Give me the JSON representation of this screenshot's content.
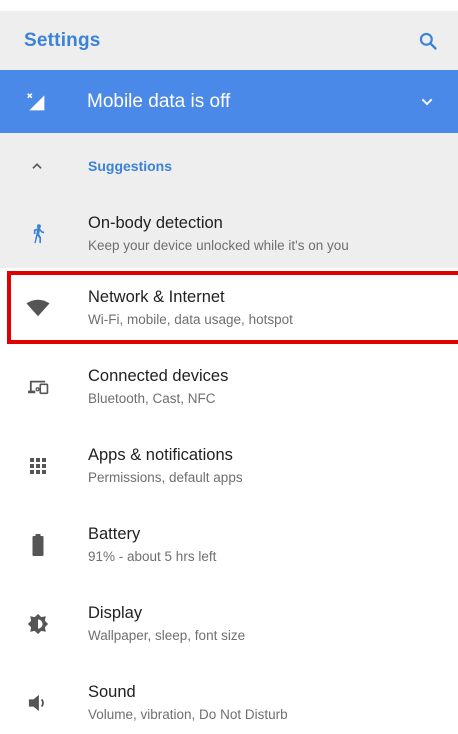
{
  "app_bar": {
    "title": "Settings",
    "search_icon": "search-icon"
  },
  "banner": {
    "text": "Mobile data is off",
    "icon": "signal-off-icon",
    "chevron": "chevron-down-icon"
  },
  "suggestions": {
    "title": "Suggestions",
    "items": [
      {
        "title": "On-body detection",
        "subtitle": "Keep your device unlocked while it's on you",
        "icon": "walking-person-icon"
      }
    ]
  },
  "settings": [
    {
      "title": "Network & Internet",
      "subtitle": "Wi-Fi, mobile, data usage, hotspot",
      "icon": "wifi-icon",
      "highlighted": true
    },
    {
      "title": "Connected devices",
      "subtitle": "Bluetooth, Cast, NFC",
      "icon": "devices-icon"
    },
    {
      "title": "Apps & notifications",
      "subtitle": "Permissions, default apps",
      "icon": "apps-grid-icon"
    },
    {
      "title": "Battery",
      "subtitle": "91% - about 5 hrs left",
      "icon": "battery-icon"
    },
    {
      "title": "Display",
      "subtitle": "Wallpaper, sleep, font size",
      "icon": "brightness-icon"
    },
    {
      "title": "Sound",
      "subtitle": "Volume, vibration, Do Not Disturb",
      "icon": "volume-icon"
    }
  ],
  "colors": {
    "accent": "#3b82d9",
    "banner": "#4a89e8",
    "highlight": "#e00000"
  }
}
